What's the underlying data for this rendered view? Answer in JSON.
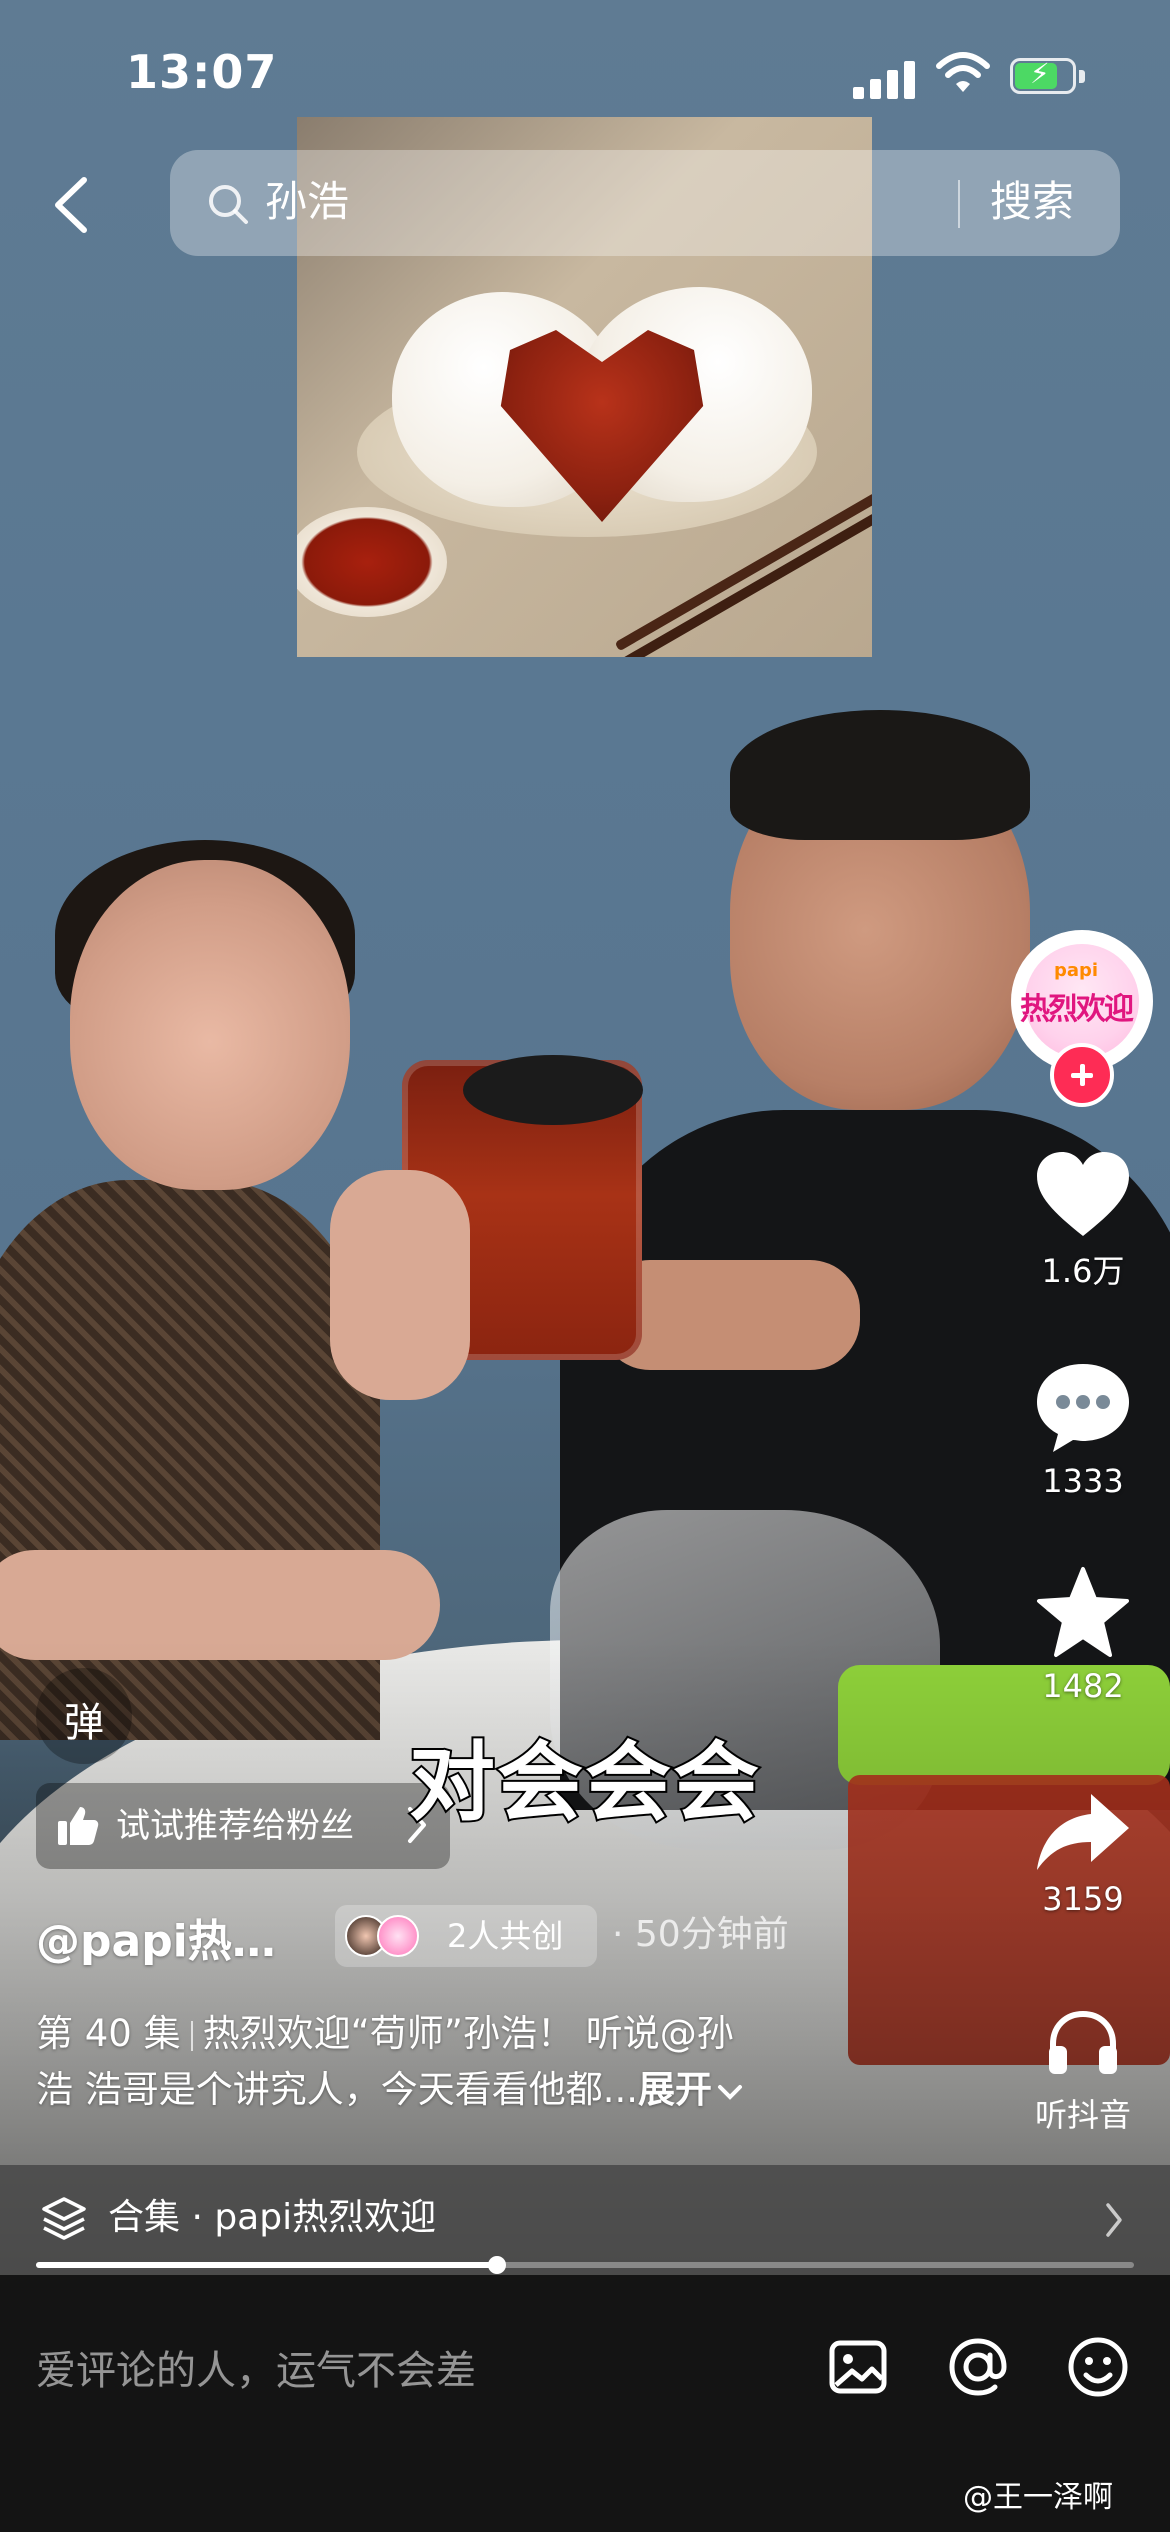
{
  "status_bar": {
    "time": "13:07",
    "battery_level": 0.75
  },
  "search": {
    "query": "孙浩",
    "button_label": "搜索"
  },
  "creator": {
    "avatar_brand": "papi",
    "avatar_text": "热烈欢迎"
  },
  "actions": {
    "likes": "1.6万",
    "comments": "1333",
    "favorites": "1482",
    "shares": "3159",
    "listen_label": "听抖音"
  },
  "danmaku_label": "弹",
  "recommend_label": "试试推荐给粉丝",
  "caption": "对会会会",
  "author": {
    "name": "@papi热…",
    "co_create": "2人共创",
    "time_ago": "· 50分钟前"
  },
  "description": {
    "episode": "第 40 集",
    "line1": "热烈欢迎“苟师”孙浩！ 听说@孙",
    "line2": "浩 浩哥是个讲究人，今天看看他都...",
    "expand_label": "展开"
  },
  "collection": {
    "label": "合集 · papi热烈欢迎",
    "progress": 0.42
  },
  "comment_bar": {
    "placeholder": "爱评论的人，运气不会差"
  },
  "watermark": "@王一泽啊",
  "icons": {
    "back": "chevron-left-icon",
    "search": "search-icon",
    "like": "heart-icon",
    "comment": "comment-bubble-icon",
    "favorite": "star-icon",
    "share": "share-arrow-icon",
    "listen": "headphones-icon",
    "collection": "layers-icon",
    "image": "image-icon",
    "mention": "at-icon",
    "emoji": "emoji-icon"
  },
  "colors": {
    "accent": "#fe2c55",
    "battery": "#4cd964",
    "avatar_brand": "#e0167f"
  }
}
